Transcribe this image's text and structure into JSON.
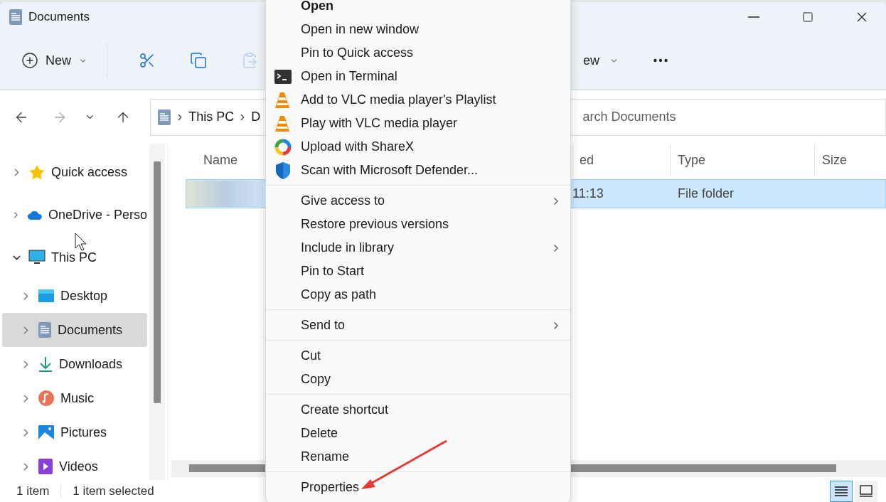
{
  "window": {
    "title": "Documents"
  },
  "toolbar": {
    "new_label": "New",
    "paste_disabled": true,
    "view_label_visible": "ew"
  },
  "navigation": {
    "forward_disabled": true,
    "breadcrumb": [
      {
        "label": "This PC"
      },
      {
        "label": "D"
      }
    ],
    "search": {
      "placeholder": "arch Documents"
    }
  },
  "sidebar": {
    "items": [
      {
        "label": "Quick access",
        "kind": "star",
        "expanded": false,
        "selected": false
      },
      {
        "label": "OneDrive - Perso",
        "kind": "cloud",
        "expanded": false,
        "selected": false
      },
      {
        "label": "This PC",
        "kind": "pc",
        "expanded": true,
        "selected": false,
        "children": [
          {
            "label": "Desktop",
            "kind": "desktop",
            "expanded": false,
            "selected": false
          },
          {
            "label": "Documents",
            "kind": "documents",
            "expanded": false,
            "selected": true
          },
          {
            "label": "Downloads",
            "kind": "downloads",
            "expanded": false,
            "selected": false
          },
          {
            "label": "Music",
            "kind": "music",
            "expanded": false,
            "selected": false
          },
          {
            "label": "Pictures",
            "kind": "pictures",
            "expanded": false,
            "selected": false
          },
          {
            "label": "Videos",
            "kind": "videos",
            "expanded": false,
            "selected": false
          }
        ]
      }
    ]
  },
  "table": {
    "columns": [
      {
        "label": "Name"
      },
      {
        "label": "ed"
      },
      {
        "label": "Type"
      },
      {
        "label": "Size"
      }
    ],
    "rows": [
      {
        "selected": true,
        "date": "11:13",
        "type": "File folder"
      }
    ]
  },
  "status_bar": {
    "count": "1 item",
    "selection": "1 item selected",
    "views": [
      {
        "kind": "details",
        "selected": true
      },
      {
        "kind": "tiles",
        "selected": false
      }
    ]
  },
  "context_menu": {
    "sections": [
      {
        "items": [
          {
            "label": "Open",
            "kind": "plain",
            "default": true,
            "submenu": false
          },
          {
            "label": "Open in new window",
            "kind": "plain",
            "default": false,
            "submenu": false
          },
          {
            "label": "Pin to Quick access",
            "kind": "plain",
            "default": false,
            "submenu": false
          },
          {
            "label": "Open in Terminal",
            "kind": "terminal",
            "default": false,
            "submenu": false
          },
          {
            "label": "Add to VLC media player's Playlist",
            "kind": "cone",
            "default": false,
            "submenu": false
          },
          {
            "label": "Play with VLC media player",
            "kind": "cone",
            "default": false,
            "submenu": false
          },
          {
            "label": "Upload with ShareX",
            "kind": "ring",
            "default": false,
            "submenu": false
          },
          {
            "label": "Scan with Microsoft Defender...",
            "kind": "shield",
            "default": false,
            "submenu": false
          }
        ]
      },
      {
        "items": [
          {
            "label": "Give access to",
            "kind": "plain",
            "default": false,
            "submenu": true
          },
          {
            "label": "Restore previous versions",
            "kind": "plain",
            "default": false,
            "submenu": false
          },
          {
            "label": "Include in library",
            "kind": "plain",
            "default": false,
            "submenu": true
          },
          {
            "label": "Pin to Start",
            "kind": "plain",
            "default": false,
            "submenu": false
          },
          {
            "label": "Copy as path",
            "kind": "plain",
            "default": false,
            "submenu": false
          }
        ]
      },
      {
        "items": [
          {
            "label": "Send to",
            "kind": "plain",
            "default": false,
            "submenu": true
          }
        ]
      },
      {
        "items": [
          {
            "label": "Cut",
            "kind": "plain",
            "default": false,
            "submenu": false
          },
          {
            "label": "Copy",
            "kind": "plain",
            "default": false,
            "submenu": false
          }
        ]
      },
      {
        "items": [
          {
            "label": "Create shortcut",
            "kind": "plain",
            "default": false,
            "submenu": false
          },
          {
            "label": "Delete",
            "kind": "plain",
            "default": false,
            "submenu": false
          },
          {
            "label": "Rename",
            "kind": "plain",
            "default": false,
            "submenu": false
          }
        ]
      },
      {
        "items": [
          {
            "label": "Properties",
            "kind": "plain",
            "default": false,
            "submenu": false
          }
        ]
      }
    ]
  }
}
